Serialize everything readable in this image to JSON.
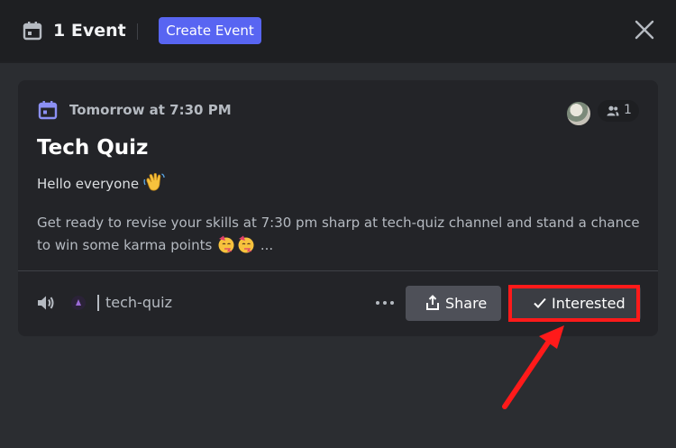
{
  "header": {
    "event_count": "1 Event",
    "create_label": "Create Event",
    "icons": {
      "calendar": "calendar-icon",
      "close": "close-icon"
    }
  },
  "event": {
    "date": "Tomorrow at 7:30 PM",
    "interested_count": "1",
    "title": "Tech Quiz",
    "greeting": "Hello everyone",
    "description": "Get ready to revise your skills at 7:30 pm sharp at tech-quiz channel and stand a chance to win some karma points",
    "ellipsis": "...",
    "channel": "tech-quiz",
    "icons": {
      "date": "calendar-icon",
      "people": "people-icon",
      "speaker": "speaker-icon",
      "wave_emoji": "waving-hand-emoji",
      "party_emoji": "partying-face-emoji"
    }
  },
  "actions": {
    "share_label": "Share",
    "interested_label": "Interested"
  },
  "colors": {
    "accent": "#5865f2",
    "background": "#2b2d31",
    "card": "#232428",
    "highlight": "#ff1a1a"
  }
}
